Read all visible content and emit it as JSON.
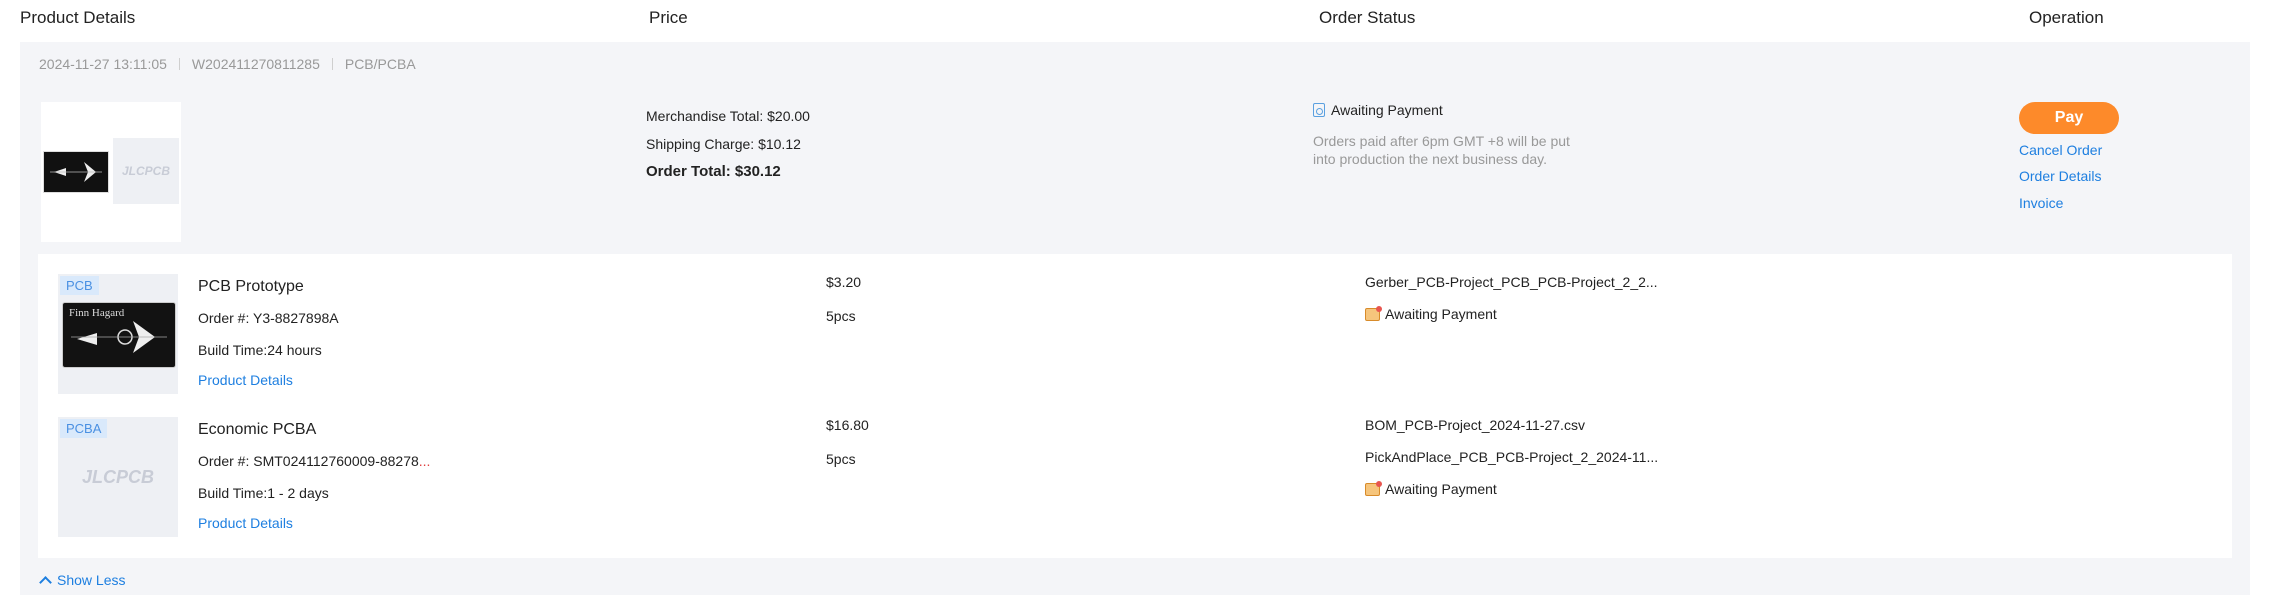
{
  "header": {
    "product_details": "Product Details",
    "price": "Price",
    "order_status": "Order Status",
    "operation": "Operation"
  },
  "order": {
    "datetime": "2024-11-27 13:11:05",
    "order_no": "W202411270811285",
    "category": "PCB/PCBA",
    "thumb_placeholder": "JLCPCB",
    "merchandise_total": "Merchandise Total: $20.00",
    "shipping_charge": "Shipping Charge: $10.12",
    "order_total": "Order Total: $30.12",
    "status": "Awaiting Payment",
    "status_note": "Orders paid after 6pm GMT +8 will be put into production the next business day.",
    "pay_label": "Pay",
    "cancel_label": "Cancel Order",
    "details_label": "Order Details",
    "invoice_label": "Invoice"
  },
  "items": [
    {
      "tag": "PCB",
      "image_text": "Finn Hagard",
      "name": "PCB Prototype",
      "order_no": "Order #: Y3-8827898A",
      "build_time": "Build Time:24 hours",
      "link": "Product Details",
      "price": "$3.20",
      "qty": "5pcs",
      "file1": "Gerber_PCB-Project_PCB_PCB-Project_2_2...",
      "status": "Awaiting Payment"
    },
    {
      "tag": "PCBA",
      "image_text": "JLCPCB",
      "name": "Economic PCBA",
      "order_no": "Order #: SMT024112760009-88278",
      "order_trunc": "...",
      "build_time": "Build Time:1 - 2 days",
      "link": "Product Details",
      "price": "$16.80",
      "qty": "5pcs",
      "file1": "BOM_PCB-Project_2024-11-27.csv",
      "file2": "PickAndPlace_PCB_PCB-Project_2_2024-11...",
      "status": "Awaiting Payment"
    }
  ],
  "show_less": "Show Less",
  "colors": {
    "accent_orange": "#fd8a2a",
    "link_blue": "#1e7fe0",
    "card_bg": "#f4f5f8"
  }
}
